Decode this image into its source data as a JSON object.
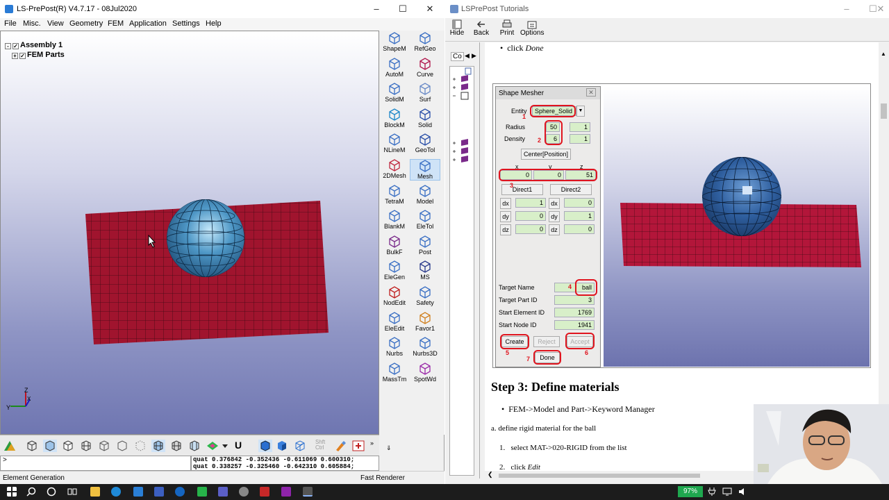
{
  "lsprepost": {
    "title": "LS-PrePost(R) V4.7.17 - 08Jul2020",
    "menu": [
      "File",
      "Misc.",
      "View",
      "Geometry",
      "FEM",
      "Application",
      "Settings",
      "Help"
    ],
    "tree": [
      "Assembly 1",
      "FEM Parts"
    ],
    "tools": [
      {
        "label": "ShapeM",
        "icon": "shape-mesher-icon"
      },
      {
        "label": "RefGeo",
        "icon": "refgeo-icon"
      },
      {
        "label": "AutoM",
        "icon": "automesh-icon"
      },
      {
        "label": "Curve",
        "icon": "curve-icon"
      },
      {
        "label": "SolidM",
        "icon": "solid-mesher-icon"
      },
      {
        "label": "Surf",
        "icon": "surface-icon"
      },
      {
        "label": "BlockM",
        "icon": "block-mesher-icon"
      },
      {
        "label": "Solid",
        "icon": "solid-icon"
      },
      {
        "label": "NLineM",
        "icon": "nline-mesher-icon"
      },
      {
        "label": "GeoTol",
        "icon": "geotol-icon"
      },
      {
        "label": "2DMesh",
        "icon": "2d-mesh-icon"
      },
      {
        "label": "Mesh",
        "icon": "mesh-icon"
      },
      {
        "label": "TetraM",
        "icon": "tetra-mesher-icon"
      },
      {
        "label": "Model",
        "icon": "model-icon"
      },
      {
        "label": "BlankM",
        "icon": "blank-mesher-icon"
      },
      {
        "label": "EleTol",
        "icon": "eletol-icon"
      },
      {
        "label": "BulkF",
        "icon": "bulk-form-icon"
      },
      {
        "label": "Post",
        "icon": "post-icon"
      },
      {
        "label": "EleGen",
        "icon": "element-generation-icon"
      },
      {
        "label": "MS",
        "icon": "ms-icon"
      },
      {
        "label": "NodEdit",
        "icon": "node-edit-icon"
      },
      {
        "label": "Safety",
        "icon": "safety-icon"
      },
      {
        "label": "EleEdit",
        "icon": "element-edit-icon"
      },
      {
        "label": "Favor1",
        "icon": "favorite-icon"
      },
      {
        "label": "Nurbs",
        "icon": "nurbs-icon"
      },
      {
        "label": "Nurbs3D",
        "icon": "nurbs3d-icon"
      },
      {
        "label": "MassTm",
        "icon": "mass-trim-icon"
      },
      {
        "label": "SpotWd",
        "icon": "spotweld-icon"
      }
    ],
    "selected_tool": "Mesh",
    "cmd_prompt": ">",
    "quat": [
      "quat 0.376842 -0.352436 -0.611069 0.600310;",
      "quat 0.338257 -0.325460 -0.642310 0.605884;"
    ],
    "status_left": "Element Generation",
    "status_right": "Fast Renderer",
    "shift_ctrl": "Shft\nCtrl",
    "u_label": "U",
    "axis": {
      "x": "X",
      "y": "Y",
      "z": "Z"
    },
    "colors": {
      "plate": "#a0142e",
      "sphere": "#3f86b8",
      "accent": "#e0141e"
    }
  },
  "tutorial": {
    "title": "LSPrePost Tutorials",
    "toolbar": [
      "Hide",
      "Back",
      "Print",
      "Options"
    ],
    "nav_tab": "Co",
    "top_bullet_prefix": "click ",
    "top_bullet_emph": "Done",
    "mesher": {
      "title": "Shape Mesher",
      "entity_label": "Entity",
      "entity_value": "Sphere_Solid",
      "radius_label": "Radius",
      "radius_value": "50",
      "radius_value2": "1",
      "density_label": "Density",
      "density_value": "6",
      "density_value2": "1",
      "center_button": "Center[Position]",
      "xyz_labels": [
        "x",
        "y",
        "z"
      ],
      "xyz_values": [
        "0",
        "0",
        "51"
      ],
      "direct1": "Direct1",
      "direct2": "Direct2",
      "dir_labels": [
        "dx",
        "dy",
        "dz"
      ],
      "dir1_values": [
        "1",
        "0",
        "0"
      ],
      "dir2_values": [
        "0",
        "1",
        "0"
      ],
      "target_name_label": "Target Name",
      "target_name_value": "ball",
      "target_part_label": "Target Part ID",
      "target_part_value": "3",
      "start_elem_label": "Start Element ID",
      "start_elem_value": "1769",
      "start_node_label": "Start Node ID",
      "start_node_value": "1941",
      "create": "Create",
      "reject": "Reject",
      "accept": "Accept",
      "done": "Done",
      "step_numbers": [
        "1",
        "2",
        "3",
        "4",
        "5",
        "6",
        "7"
      ]
    },
    "step_heading": "Step 3: Define materials",
    "bullet": "FEM->Model and Part->Keyword Manager",
    "line_a": "a. define rigid material for the ball",
    "list_item1_num": "1.",
    "list_item1": "select MAT->020-RIGID from the list",
    "list_item2_num": "2.",
    "list_item2_prefix": "click ",
    "list_item2_emph": "Edit"
  },
  "taskbar": {
    "battery": "97%"
  }
}
